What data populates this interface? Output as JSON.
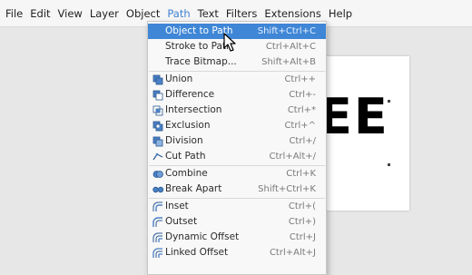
{
  "menubar": {
    "items": [
      {
        "label": "File"
      },
      {
        "label": "Edit"
      },
      {
        "label": "View"
      },
      {
        "label": "Layer"
      },
      {
        "label": "Object"
      },
      {
        "label": "Path"
      },
      {
        "label": "Text"
      },
      {
        "label": "Filters"
      },
      {
        "label": "Extensions"
      },
      {
        "label": "Help"
      }
    ],
    "active": "Path"
  },
  "canvas": {
    "text": "EE"
  },
  "path_menu": {
    "items": [
      {
        "label": "Object to Path",
        "shortcut": "Shift+Ctrl+C",
        "icon": "object-to-path-icon"
      },
      {
        "label": "Stroke to Path",
        "shortcut": "Ctrl+Alt+C",
        "icon": "stroke-to-path-icon"
      },
      {
        "label": "Trace Bitmap...",
        "shortcut": "Shift+Alt+B",
        "icon": "trace-bitmap-icon"
      },
      {
        "label": "Union",
        "shortcut": "Ctrl++",
        "icon": "union-icon"
      },
      {
        "label": "Difference",
        "shortcut": "Ctrl+-",
        "icon": "difference-icon"
      },
      {
        "label": "Intersection",
        "shortcut": "Ctrl+*",
        "icon": "intersection-icon"
      },
      {
        "label": "Exclusion",
        "shortcut": "Ctrl+^",
        "icon": "exclusion-icon"
      },
      {
        "label": "Division",
        "shortcut": "Ctrl+/",
        "icon": "division-icon"
      },
      {
        "label": "Cut Path",
        "shortcut": "Ctrl+Alt+/",
        "icon": "cut-path-icon"
      },
      {
        "label": "Combine",
        "shortcut": "Ctrl+K",
        "icon": "combine-icon"
      },
      {
        "label": "Break Apart",
        "shortcut": "Shift+Ctrl+K",
        "icon": "break-apart-icon"
      },
      {
        "label": "Inset",
        "shortcut": "Ctrl+(",
        "icon": "inset-icon"
      },
      {
        "label": "Outset",
        "shortcut": "Ctrl+)",
        "icon": "outset-icon"
      },
      {
        "label": "Dynamic Offset",
        "shortcut": "Ctrl+J",
        "icon": "dynamic-offset-icon"
      },
      {
        "label": "Linked Offset",
        "shortcut": "Ctrl+Alt+J",
        "icon": "linked-offset-icon"
      }
    ],
    "highlighted_index": 0
  },
  "colors": {
    "highlight": "#3f86d6",
    "menubar_bg": "#f6f6f6",
    "dropdown_bg": "#f8f8f8",
    "active_menu_text": "#3f7fd1"
  }
}
